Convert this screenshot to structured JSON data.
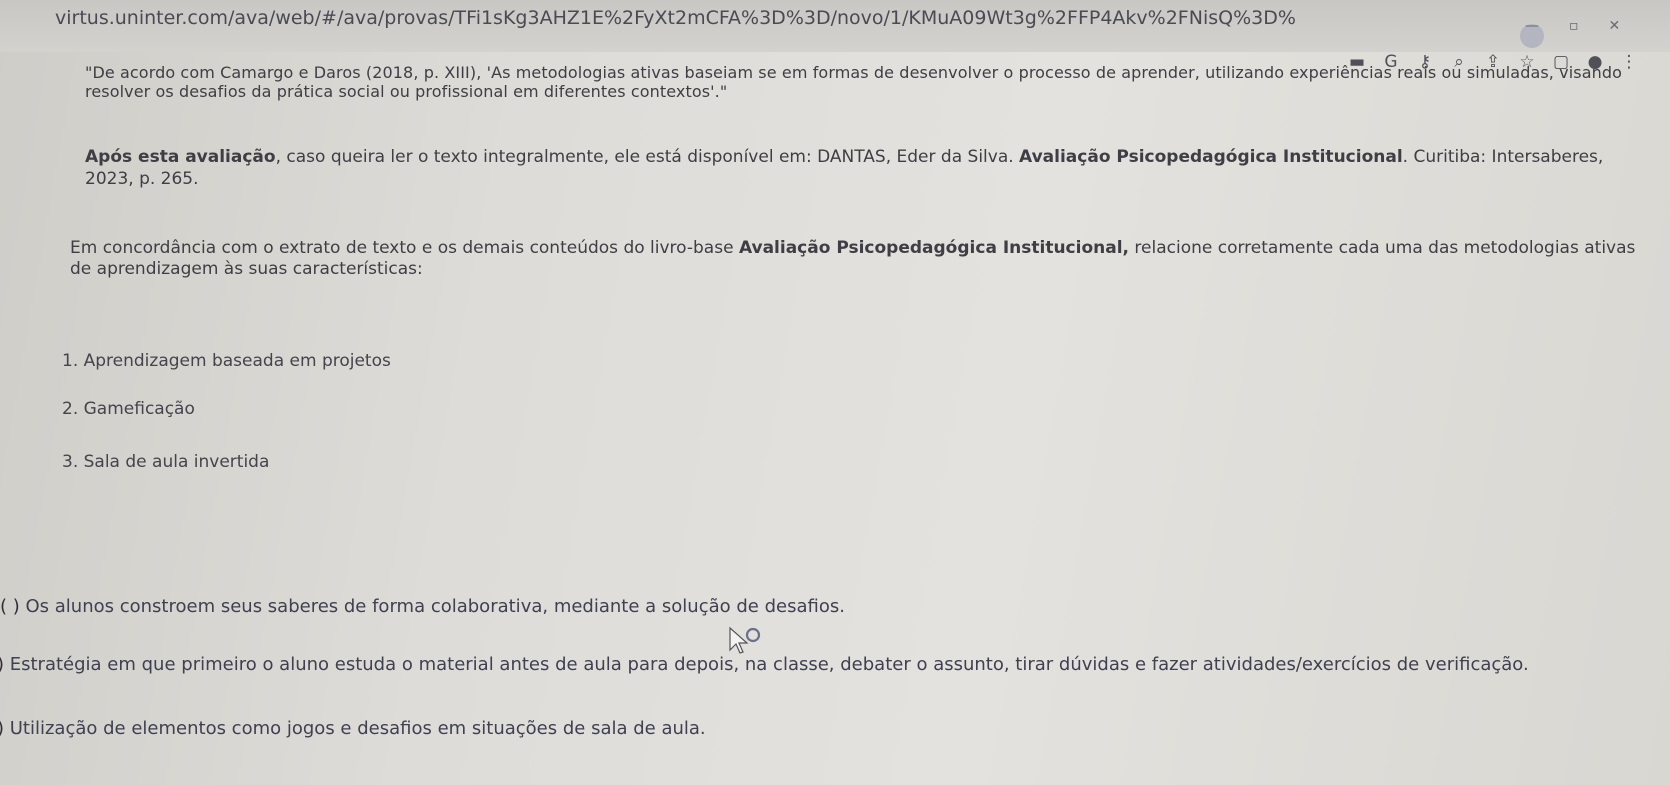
{
  "browser": {
    "url": "virtus.uninter.com/ava/web/#/ava/provas/TFi1sKg3AHZ1E%2FyXt2mCFA%3D%3D/novo/1/KMuA09Wt3g%2FFP4Akv%2FNisQ%3D%3D"
  },
  "question": {
    "quote": "\"De acordo com Camargo e Daros (2018, p. XIII), 'As metodologias ativas baseiam se em formas de desenvolver o processo de aprender, utilizando experiências reais ou simuladas, visando resolver os desafios da prática social ou profissional em diferentes contextos'.\"",
    "source_bold_lead": "Após esta avaliação",
    "source_text": ", caso queira ler o texto integralmente, ele está disponível em: DANTAS, Eder da Silva. ",
    "source_bold_title": "Avaliação Psicopedagógica Institucional",
    "source_tail": ". Curitiba: Intersaberes, 2023, p. 265.",
    "instruction_start": "Em concordância com o extrato de texto e os demais conteúdos do livro-base ",
    "instruction_bold": "Avaliação Psicopedagógica Institucional,",
    "instruction_end": " relacione corretamente cada uma das metodologias ativas de aprendizagem às suas características:",
    "items": [
      "1. Aprendizagem baseada em projetos",
      "2. Gameficação",
      "3. Sala de aula invertida"
    ],
    "statements": [
      {
        "paren": "( )",
        "text": " Os alunos constroem seus saberes de forma colaborativa, mediante a solução de desafios."
      },
      {
        "paren": ")",
        "text": " Estratégia em que primeiro o aluno estuda o material antes de aula para depois, na classe, debater o assunto, tirar dúvidas e fazer atividades/exercícios de verificação."
      },
      {
        "paren": ")",
        "text": " Utilização de elementos como jogos e desafios em situações de sala de aula."
      }
    ]
  }
}
